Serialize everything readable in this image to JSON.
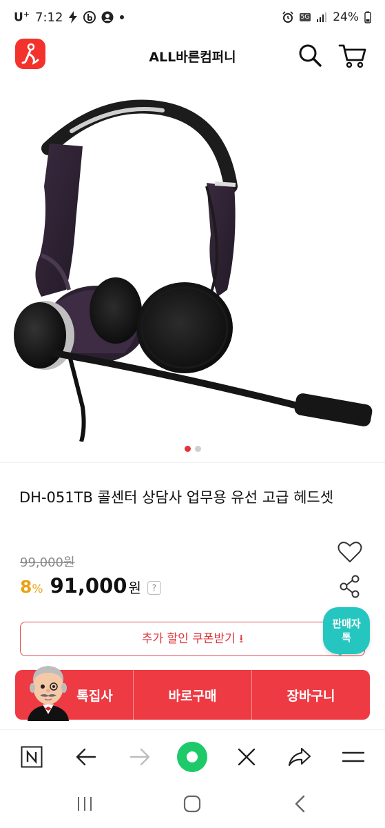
{
  "status_bar": {
    "carrier": "U",
    "carrier_sup": "+",
    "time": "7:12",
    "network": "5G",
    "battery": "24%"
  },
  "header": {
    "store_name": "ALL바른컴퍼니",
    "icons": [
      "app-logo-icon",
      "search-icon",
      "cart-icon"
    ]
  },
  "gallery": {
    "image": "headset-product-photo",
    "page_count": 2,
    "current_page": 1
  },
  "product": {
    "title": "DH-051TB 콜센터 상담사 업무용 유선 고급 헤드셋",
    "original_price": "99,000원",
    "discount": "8",
    "discount_unit": "%",
    "sale_price": "91,000",
    "currency": "원",
    "help_mark": "?"
  },
  "coupon": {
    "label": "추가 할인 쿠폰받기 ⭳"
  },
  "seller_talk": {
    "line1": "판매자",
    "line2": "톡"
  },
  "actions": {
    "special": "톡집사",
    "buy_now": "바로구매",
    "cart": "장바구니"
  },
  "colors": {
    "accent": "#ee3a43",
    "discount": "#e8a316",
    "seller_talk": "#25c6c0",
    "browser_home": "#1ec96a"
  },
  "browser_bar": {
    "icons": [
      "naver-n-icon",
      "back-arrow-icon",
      "forward-arrow-icon",
      "home-circle-icon",
      "close-icon",
      "share-arrow-icon",
      "menu-icon"
    ]
  },
  "system_nav": {
    "icons": [
      "recent-apps-icon",
      "home-icon",
      "back-icon"
    ]
  }
}
